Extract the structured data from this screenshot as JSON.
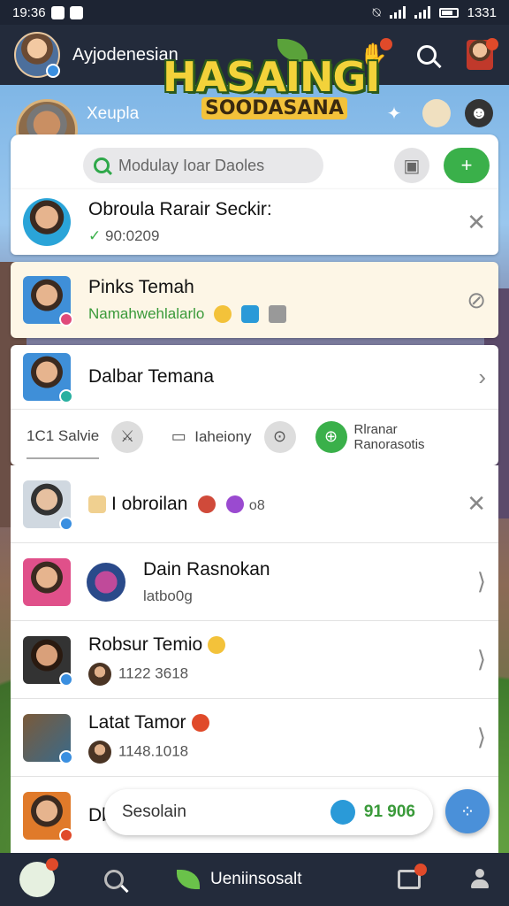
{
  "status_bar": {
    "time": "19:36",
    "right_text": "1331"
  },
  "top_bar": {
    "username": "Ayjodenesian",
    "logo_title": "HASAINGI",
    "logo_subtitle": "SOODASANA"
  },
  "profile": {
    "name": "Xeupla"
  },
  "search": {
    "placeholder": "Modulay Ioar Daoles",
    "add_label": "+"
  },
  "friend_request": {
    "title": "Obroula Rarair Seckir:",
    "sub": "90:0209"
  },
  "friends_card": {
    "title": "Pinks Temah",
    "sub": "Namahwehlalarlo"
  },
  "list_header": {
    "title": "Dalbar Temana"
  },
  "tabs": [
    {
      "label": "1C1 Salvie"
    },
    {
      "label": "Iaheiony"
    },
    {
      "label": "Rlranar Ranorasotis"
    }
  ],
  "feed": [
    {
      "title": "I obroilan",
      "sub": "o8",
      "action": "✕"
    },
    {
      "title": "Dain Rasnokan",
      "sub": "latbo0g",
      "action": "⟩"
    },
    {
      "title": "Robsur Temio",
      "sub": "1122 3618",
      "action": "⟩"
    },
    {
      "title": "Latat Tamor",
      "sub": "1148.1018",
      "action": "⟩"
    },
    {
      "title": "Dbs",
      "sub": "",
      "action": ""
    }
  ],
  "float_pill": {
    "text": "Sesolain",
    "number": "91 906"
  },
  "bottom_nav": {
    "label": "Ueniinsosalt"
  },
  "colors": {
    "accent_green": "#3ab04a",
    "topbar": "#232b3b",
    "friend_bg": "#fdf6e6",
    "fab_blue": "#4a90d9"
  }
}
